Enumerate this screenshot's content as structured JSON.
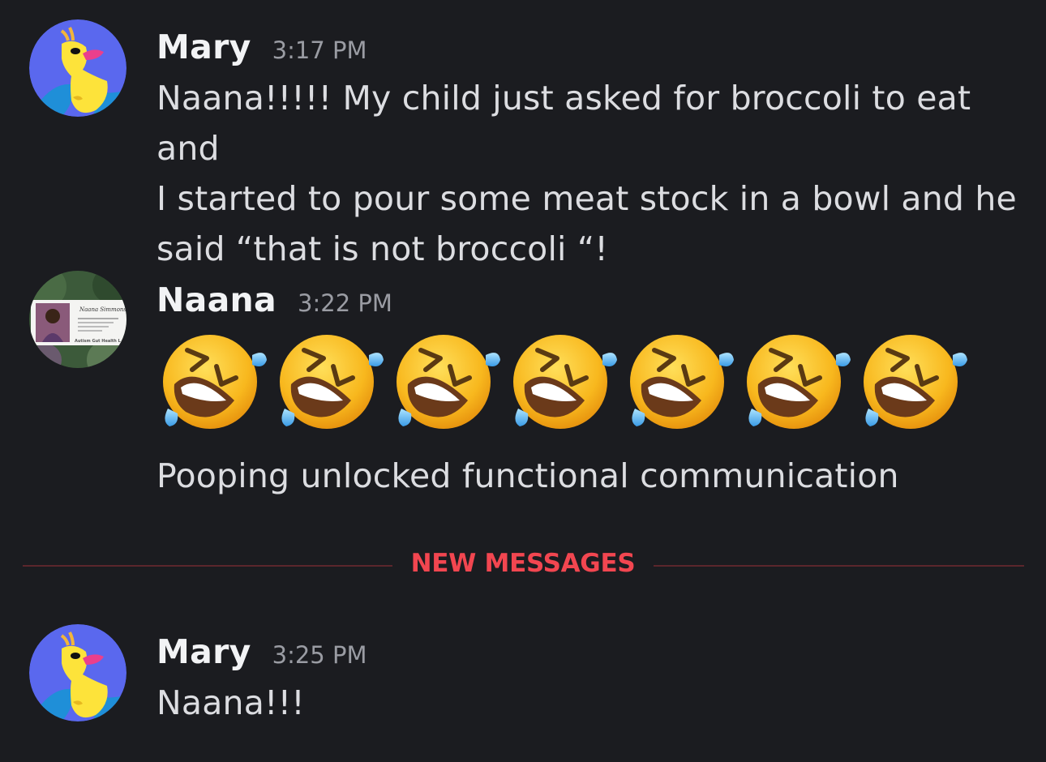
{
  "messages": [
    {
      "username": "Mary",
      "timestamp": "3:17 PM",
      "lines": [
        "Naana!!!!! My child  just asked for broccoli to eat and",
        "I started to pour some meat stock in a bowl and he",
        "said “that is not broccoli “!"
      ],
      "avatar": "duck-avatar-icon"
    },
    {
      "username": "Naana",
      "timestamp": "3:22 PM",
      "emoji": [
        "rofl-emoji",
        "rofl-emoji",
        "rofl-emoji",
        "rofl-emoji",
        "rofl-emoji",
        "rofl-emoji",
        "rofl-emoji"
      ],
      "text": "Pooping unlocked functional communication",
      "avatar": "photo-avatar",
      "avatar_card_name": "Naana Simmons",
      "avatar_card_footer": "Autism Gut Health L"
    },
    {
      "username": "Mary",
      "timestamp": "3:25 PM",
      "text": "Naana!!!",
      "avatar": "duck-avatar-icon"
    }
  ],
  "divider": {
    "label": "NEW MESSAGES",
    "color": "#f24650"
  },
  "colors": {
    "background": "#1b1c20",
    "avatar_blue": "#5865f2",
    "duck_yellow": "#fde33a"
  }
}
